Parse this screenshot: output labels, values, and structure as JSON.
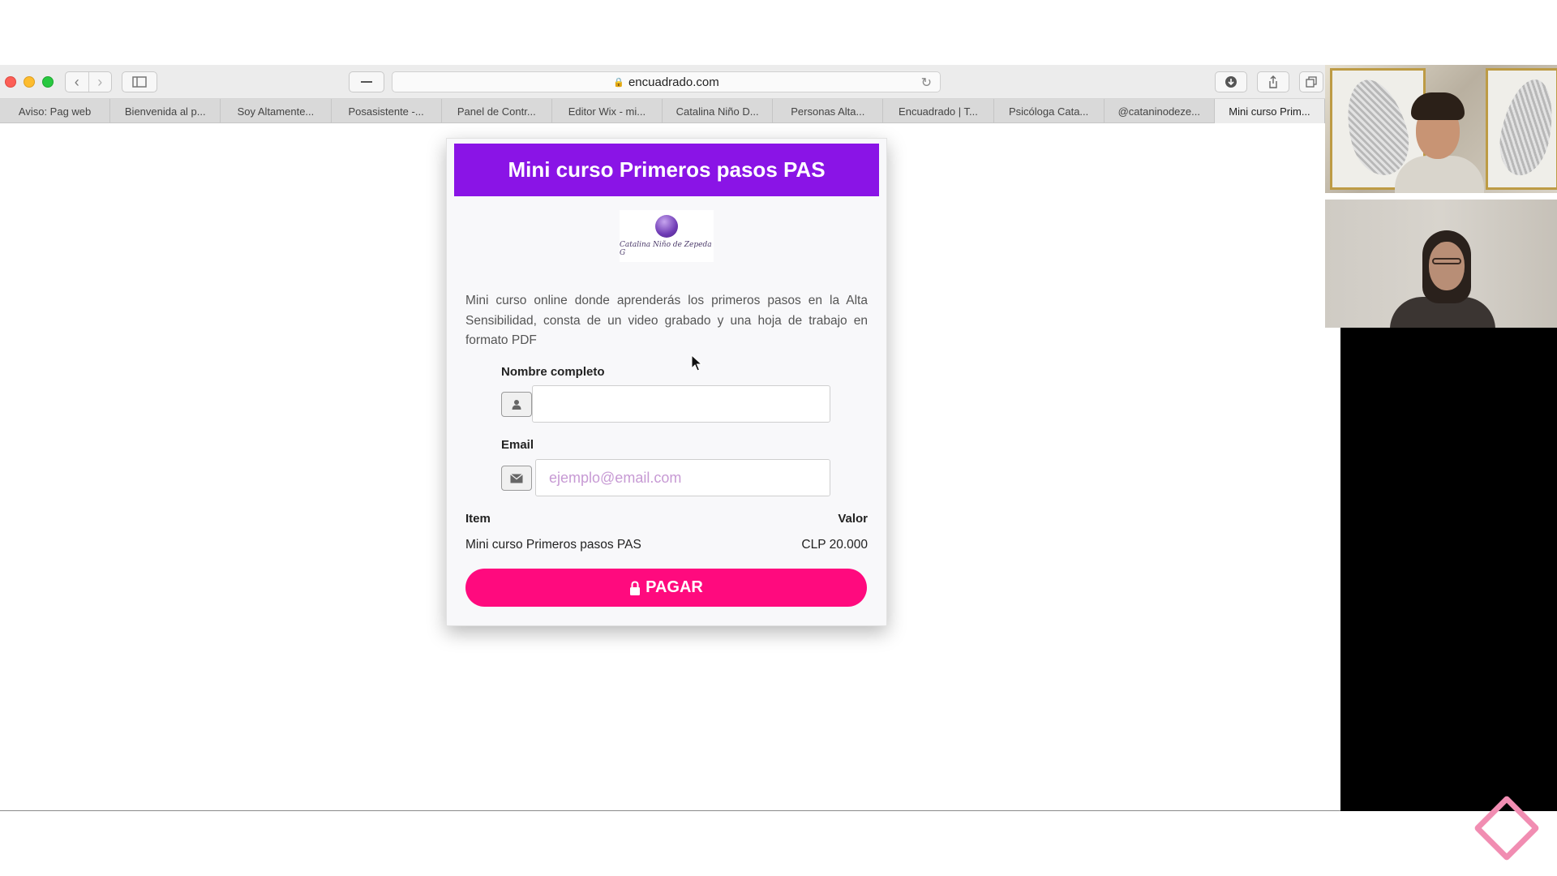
{
  "browser": {
    "url": "encuadrado.com",
    "tabs": [
      {
        "label": "Aviso: Pag web"
      },
      {
        "label": "Bienvenida al p..."
      },
      {
        "label": "Soy Altamente..."
      },
      {
        "label": "Posasistente -..."
      },
      {
        "label": "Panel de Contr..."
      },
      {
        "label": "Editor Wix - mi..."
      },
      {
        "label": "Catalina Niño D..."
      },
      {
        "label": "Personas Alta..."
      },
      {
        "label": "Encuadrado | T..."
      },
      {
        "label": "Psicóloga Cata..."
      },
      {
        "label": "@cataninodeze..."
      },
      {
        "label": "Mini curso Prim..."
      }
    ]
  },
  "card": {
    "title": "Mini curso Primeros pasos PAS",
    "logo_text": "Catalina Niño de Zepeda G",
    "description": "Mini curso online donde aprenderás los primeros pasos en la Alta Sensibilidad, consta de un video grabado y una hoja de trabajo en formato PDF",
    "name_label": "Nombre completo",
    "name_value": "",
    "email_label": "Email",
    "email_placeholder": "ejemplo@email.com",
    "item_header": "Item",
    "value_header": "Valor",
    "item_name": "Mini curso Primeros pasos PAS",
    "item_value": "CLP 20.000",
    "pay_label": "PAGAR"
  },
  "colors": {
    "header_purple": "#8a14e6",
    "pay_pink": "#ff0a7e",
    "placeholder": "#c79ad4"
  }
}
